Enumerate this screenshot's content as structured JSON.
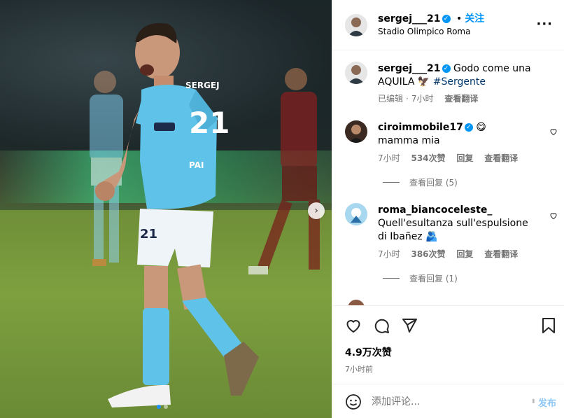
{
  "post": {
    "author": "sergej___21",
    "follow_label": "关注",
    "dot": "•",
    "location": "Stadio Olimpico Roma",
    "more_icon": "more-horizontal-icon"
  },
  "caption": {
    "author": "sergej___21",
    "text_before": "Godo come una AQUILA",
    "emoji": "🦅",
    "hashtag": "#Sergente",
    "edited": "已编辑",
    "time": "7小时",
    "translate": "查看翻译"
  },
  "comments": [
    {
      "author": "ciroimmobile17",
      "emoji": "😋",
      "text": "mamma mia",
      "time": "7小时",
      "likes": "534次赞",
      "reply": "回复",
      "translate": "查看翻译",
      "view_replies": "查看回复 (5)"
    },
    {
      "author": "roma_biancoceleste_",
      "text": "Quell'esultanza sull'espulsione di Ibañez",
      "emoji": "🫂",
      "time": "7小时",
      "likes": "386次赞",
      "reply": "回复",
      "translate": "查看翻译",
      "view_replies": "查看回复 (1)"
    }
  ],
  "stats": {
    "likes": "4.9万次赞",
    "time_ago": "7小时前"
  },
  "composer": {
    "placeholder": "添加评论...",
    "post_label": "发布"
  }
}
